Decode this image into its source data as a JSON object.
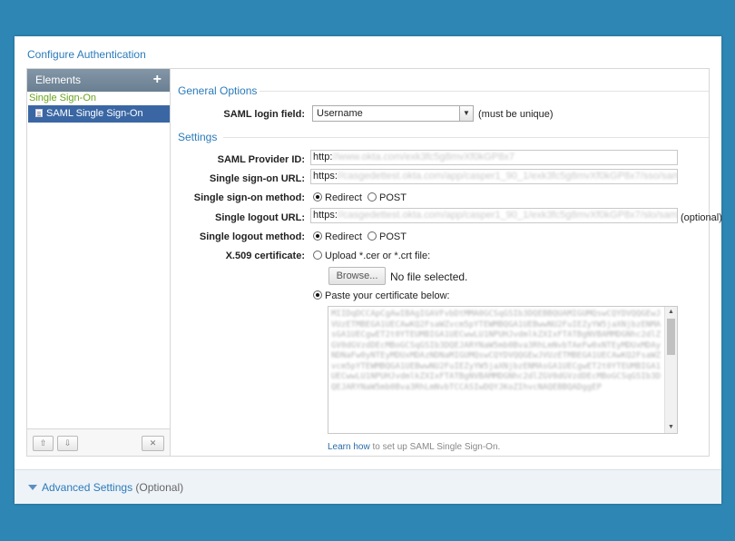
{
  "panel": {
    "title": "Configure Authentication"
  },
  "sidebar": {
    "header": "Elements",
    "add_icon": "+",
    "group": "Single Sign-On",
    "items": [
      {
        "label": "SAML Single Sign-On"
      }
    ],
    "move_up_icon": "⇧",
    "move_down_icon": "⇩",
    "delete_icon": "✕"
  },
  "general": {
    "title": "General Options",
    "login_field_label": "SAML login field:",
    "login_field_value": "Username",
    "login_field_note": "(must be unique)"
  },
  "settings": {
    "title": "Settings",
    "provider_id_label": "SAML Provider ID:",
    "provider_id_prefix": "http:",
    "provider_id_value": "//www.okta.com/exk3fc5g8mvXf0kGP8x7",
    "sso_url_label": "Single sign-on URL:",
    "sso_url_prefix": "https:",
    "sso_url_value": "//casgedettest.okta.com/app/casper1_90_1/exk3fc5g8mvXf0kGP8x7/sso/saml",
    "sso_method_label": "Single sign-on method:",
    "sso_method_options": [
      "Redirect",
      "POST"
    ],
    "logout_url_label": "Single logout URL:",
    "logout_url_prefix": "https:",
    "logout_url_value": "//casgedettest.okta.com/app/casper1_90_1/exk3fc5g8mvXf0kGP8x7/slo/saml",
    "logout_url_note": "(optional)",
    "logout_method_label": "Single logout method:",
    "logout_method_options": [
      "Redirect",
      "POST"
    ],
    "cert_label": "X.509 certificate:",
    "upload_option": "Upload *.cer or *.crt file:",
    "browse_label": "Browse...",
    "no_file_text": "No file selected.",
    "paste_option": "Paste your certificate below:",
    "cert_text": "MIIDqDCCApCgAwIBAgIGAVFvbDtMMA0GCSqGSIb3DQEBBQUAMIGUMQswCQYDVQQGEwJVUzETMBEGA1UECAwKQ2FsaWZvcm5pYTEWMBQGA1UEBwwNU2FuIEZyYW5jaXNjbzENMAsGA1UECgwET2t0YTEUMBIGA1UECwwLU1NPUHJvdmlkZXIxFTATBgNVBAMMDGNhc2dlZGV0dGVzdDEcMBoGCSqGSIb3DQEJARYNaW5mb0Bva3RhLmNvbTAeFw0xNTEyMDUxMDAyNDNaFw0yNTEyMDUxMDAzNDNaMIGUMQswCQYDVQQGEwJVUzETMBEGA1UECAwKQ2FsaWZvcm5pYTEWMBQGA1UEBwwNU2FuIEZyYW5jaXNjbzENMAsGA1UECgwET2t0YTEUMBIGA1UECwwLU1NPUHJvdmlkZXIxFTATBgNVBAMMDGNhc2dlZGV0dGVzdDEcMBoGCSqGSIb3DQEJARYNaW5mb0Bva3RhLmNvbTCCASIwDQYJKoZIhvcNAQEBBQADggEP",
    "learn_link": "Learn how",
    "learn_rest": " to set up SAML Single Sign-On."
  },
  "advanced": {
    "label": "Advanced Settings",
    "optional": " (Optional)"
  }
}
